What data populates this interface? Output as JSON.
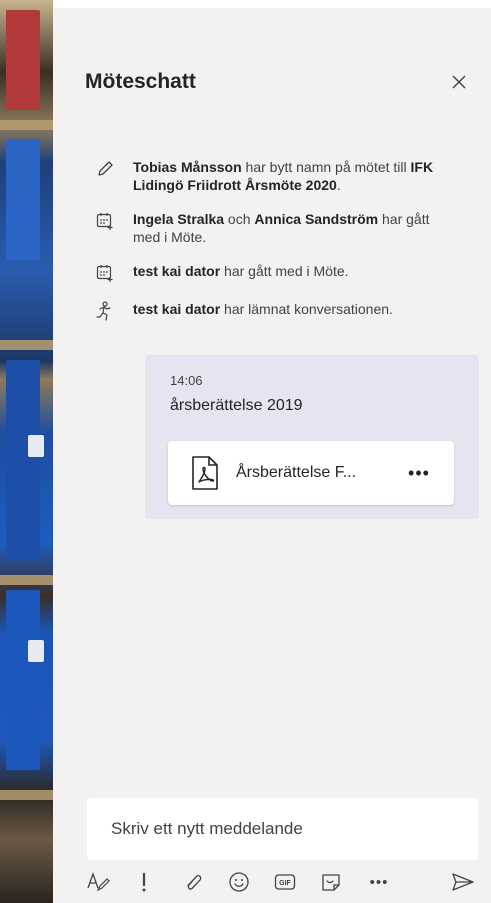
{
  "panel": {
    "title": "Möteschatt"
  },
  "events": [
    {
      "icon": "pencil-icon",
      "parts": [
        {
          "t": "Tobias Månsson",
          "b": true
        },
        {
          "t": " har bytt namn på mötet till ",
          "b": false
        },
        {
          "t": "IFK Lidingö Friidrott Årsmöte 2020",
          "b": true
        },
        {
          "t": ".",
          "b": false
        }
      ]
    },
    {
      "icon": "calendar-join-icon",
      "parts": [
        {
          "t": "Ingela Stralka",
          "b": true
        },
        {
          "t": " och ",
          "b": false
        },
        {
          "t": "Annica Sandström",
          "b": true
        },
        {
          "t": " har gått med i Möte.",
          "b": false
        }
      ]
    },
    {
      "icon": "calendar-join-icon",
      "parts": [
        {
          "t": "test kai dator",
          "b": true
        },
        {
          "t": " har gått med i Möte.",
          "b": false
        }
      ]
    },
    {
      "icon": "person-leave-icon",
      "parts": [
        {
          "t": "test kai dator",
          "b": true
        },
        {
          "t": " har lämnat konversationen.",
          "b": false
        }
      ]
    }
  ],
  "message": {
    "time": "14:06",
    "text": "årsberättelse 2019",
    "attachment": {
      "name": "Årsberättelse F...",
      "icon": "pdf-file-icon",
      "more": "•••"
    }
  },
  "compose": {
    "placeholder": "Skriv ett nytt meddelande"
  },
  "toolbar": {
    "items": [
      "format-icon",
      "important-icon",
      "attach-icon",
      "emoji-icon",
      "gif-icon",
      "sticker-icon",
      "more-options-icon",
      "send-icon"
    ],
    "gif_label": "GIF",
    "more_label": "•••"
  },
  "colors": {
    "panel_bg": "#f3f2f1",
    "bubble_bg": "#e5e5f1",
    "icon": "#424242"
  }
}
